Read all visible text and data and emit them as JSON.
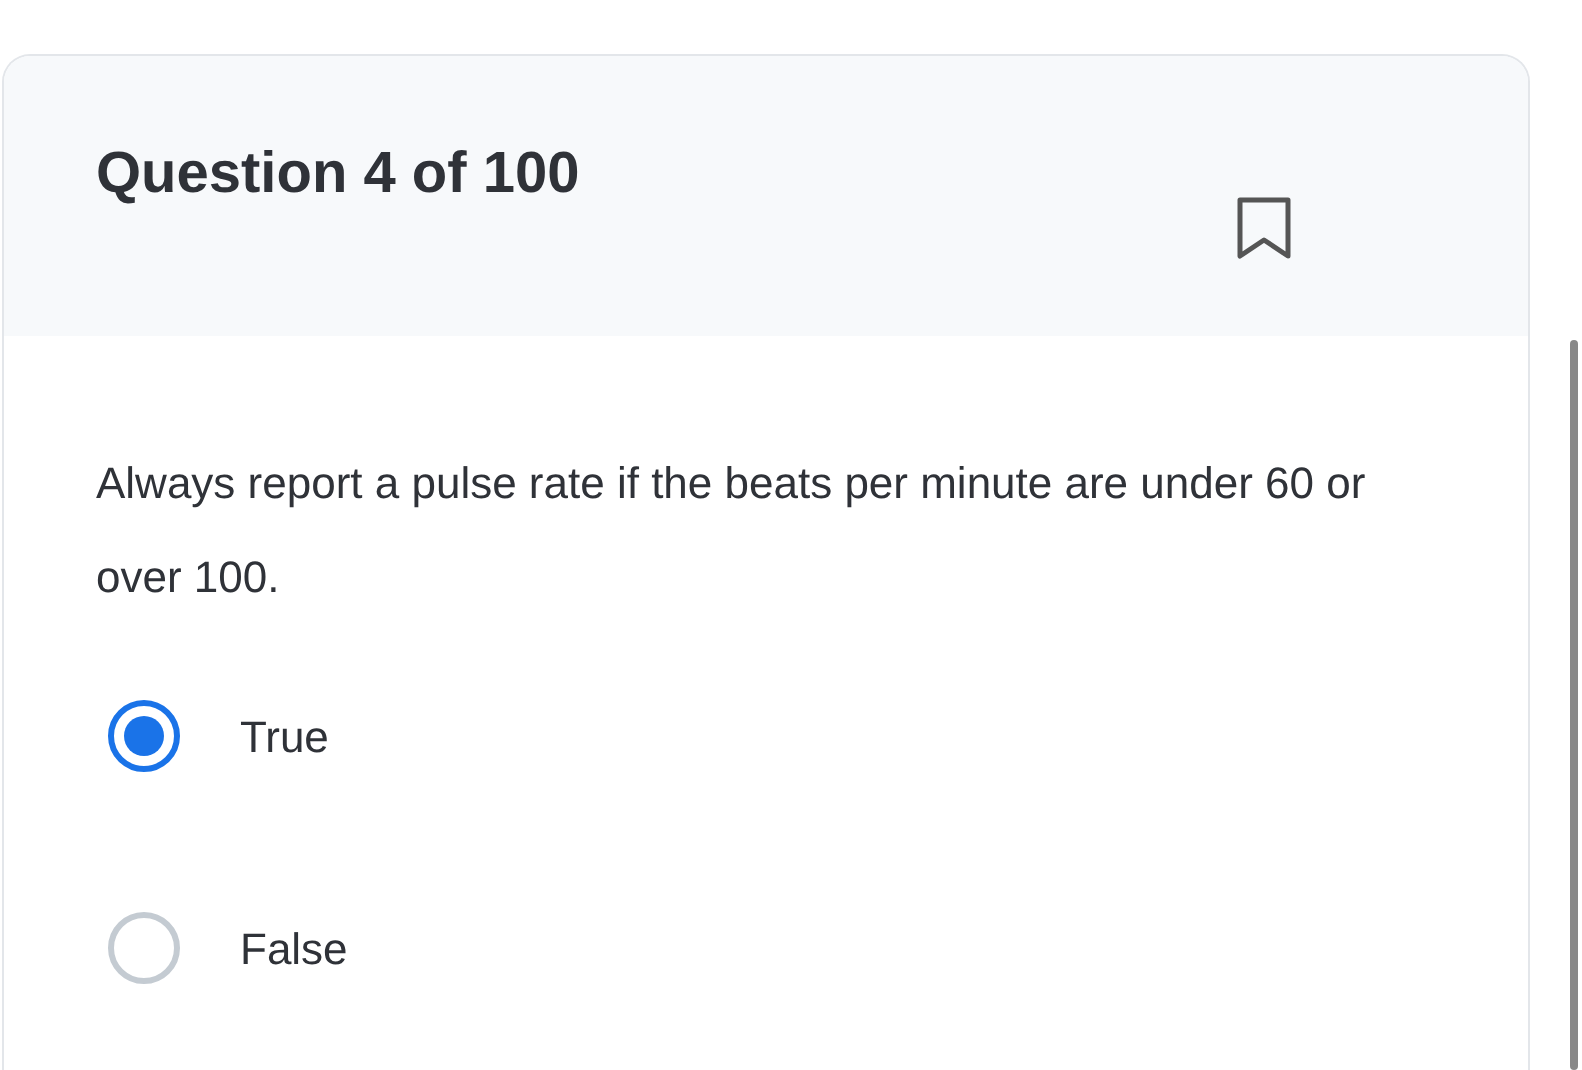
{
  "question": {
    "title": "Question 4 of 100",
    "bookmarked": false,
    "text": "Always report a pulse rate if the beats per minute are under 60 or over 100."
  },
  "options": [
    {
      "label": "True",
      "selected": true
    },
    {
      "label": "False",
      "selected": false
    }
  ]
}
